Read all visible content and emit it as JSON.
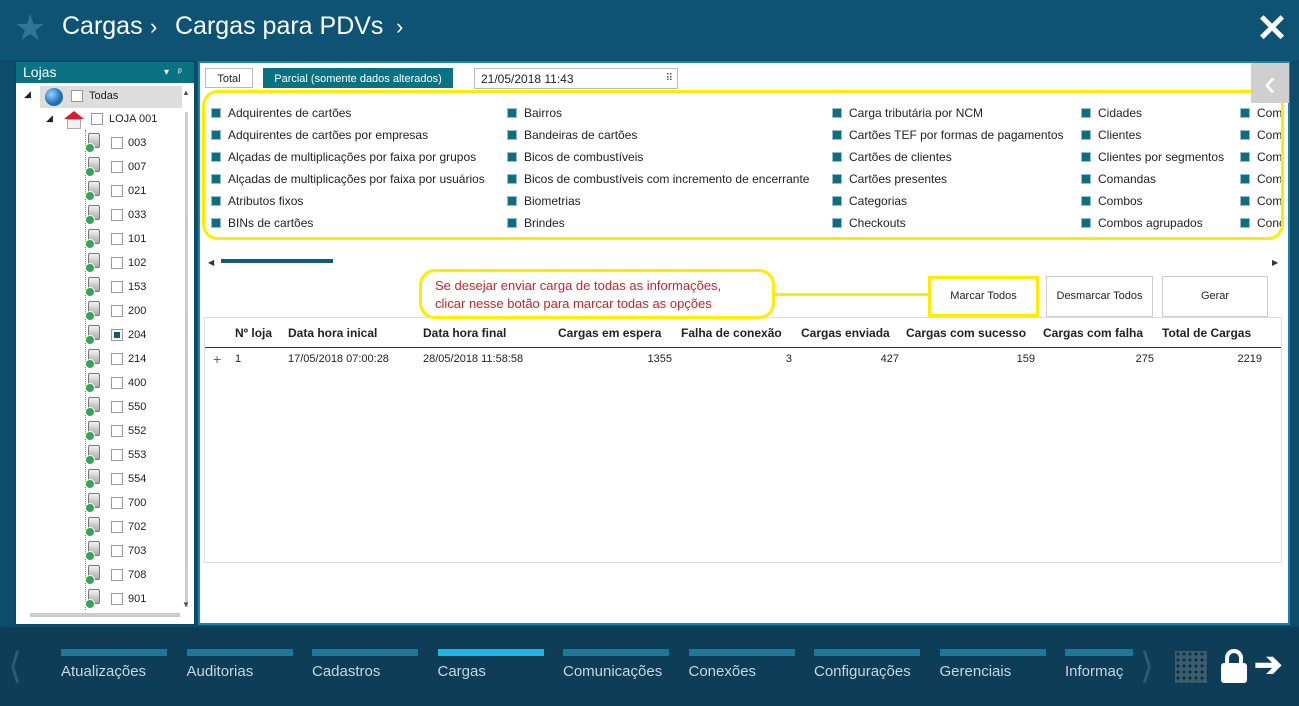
{
  "header": {
    "crumb1": "Cargas",
    "sep1": "›",
    "crumb2": "Cargas para PDVs",
    "sep2": "›",
    "close_symbol": "✕",
    "star_symbol": "★"
  },
  "left_panel": {
    "title": "Lojas",
    "root_label": "Todas",
    "store_label": "LOJA 001",
    "pdvs": [
      {
        "code": "003",
        "checked": false
      },
      {
        "code": "007",
        "checked": false
      },
      {
        "code": "021",
        "checked": false
      },
      {
        "code": "033",
        "checked": false
      },
      {
        "code": "101",
        "checked": false
      },
      {
        "code": "102",
        "checked": false
      },
      {
        "code": "153",
        "checked": false
      },
      {
        "code": "200",
        "checked": false
      },
      {
        "code": "204",
        "checked": true
      },
      {
        "code": "214",
        "checked": false
      },
      {
        "code": "400",
        "checked": false
      },
      {
        "code": "550",
        "checked": false
      },
      {
        "code": "552",
        "checked": false
      },
      {
        "code": "553",
        "checked": false
      },
      {
        "code": "554",
        "checked": false
      },
      {
        "code": "700",
        "checked": false
      },
      {
        "code": "702",
        "checked": false
      },
      {
        "code": "703",
        "checked": false
      },
      {
        "code": "708",
        "checked": false
      },
      {
        "code": "901",
        "checked": false
      }
    ]
  },
  "tabs": {
    "total": "Total",
    "parcial": "Parcial (somente dados alterados)"
  },
  "date_value": "21/05/2018 11:43",
  "options_columns": [
    [
      "Adquirentes de cartões",
      "Adquirentes de cartões por empresas",
      "Alçadas de multiplicações por faixa por grupos",
      "Alçadas de multiplicações por faixa por usuários",
      "Atributos fixos",
      "BINs de cartões"
    ],
    [
      "Bairros",
      "Bandeiras de cartões",
      "Bicos de combustíveis",
      "Bicos de combustíveis com incremento de encerrante",
      "Biometrias",
      "Brindes"
    ],
    [
      "Carga tributária por NCM",
      "Cartões TEF por formas de pagamentos",
      "Cartões de clientes",
      "Cartões presentes",
      "Categorias",
      "Checkouts"
    ],
    [
      "Cidades",
      "Clientes",
      "Clientes por segmentos",
      "Comandas",
      "Combos",
      "Combos agrupados"
    ],
    [
      "Com",
      "Com",
      "Com",
      "Com",
      "Com",
      "Conc"
    ]
  ],
  "callout": {
    "line1": "Se desejar enviar carga de todas as informações,",
    "line2": "clicar nesse botão para marcar todas as opções"
  },
  "buttons": {
    "marcar": "Marcar Todos",
    "desmarcar": "Desmarcar Todos",
    "gerar": "Gerar"
  },
  "table": {
    "headers": [
      "Nº loja",
      "Data hora inical",
      "Data hora final",
      "Cargas em espera",
      "Falha de conexão",
      "Cargas enviada",
      "Cargas com sucesso",
      "Cargas com falha",
      "Total de Cargas"
    ],
    "rows": [
      [
        "1",
        "17/05/2018 07:00:28",
        "28/05/2018 11:58:58",
        "1355",
        "3",
        "427",
        "159",
        "275",
        "2219"
      ]
    ]
  },
  "bottom_nav": {
    "items": [
      "Atualizações",
      "Auditorias",
      "Cadastros",
      "Cargas",
      "Comunicações",
      "Conexões",
      "Configurações",
      "Gerenciais",
      "Informaç"
    ],
    "active_index": 3
  },
  "colors": {
    "header_bg": "#0f5374",
    "tab_active": "#0b7283",
    "highlight": "#ffec00",
    "callout_text": "#c0272d"
  }
}
